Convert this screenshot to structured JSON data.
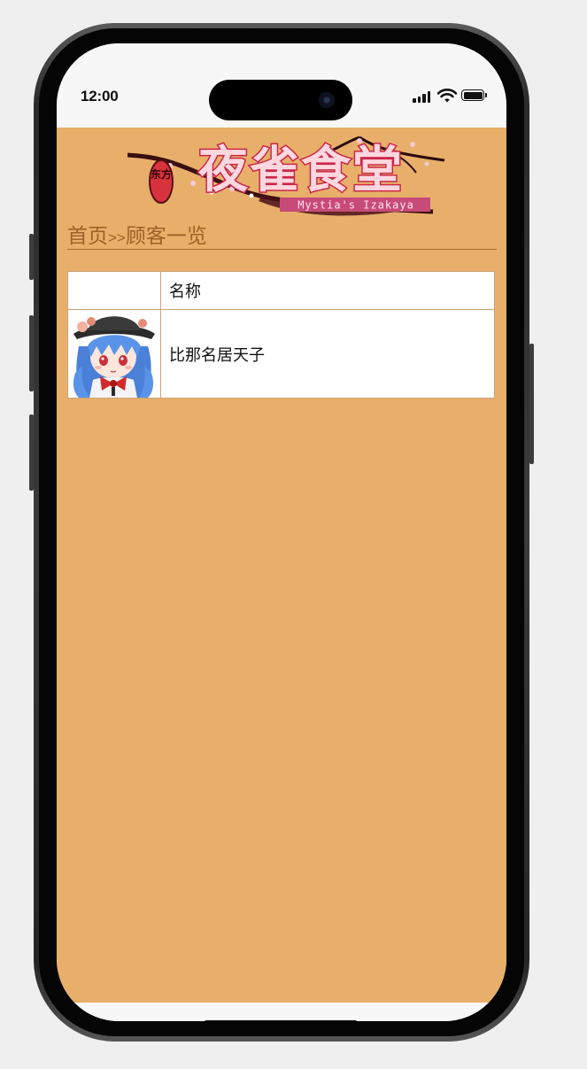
{
  "status_bar": {
    "time": "12:00"
  },
  "banner": {
    "title": "夜雀食堂",
    "badge": "东方",
    "subtitle": "Mystia's Izakaya"
  },
  "breadcrumb": {
    "home": "首页",
    "separator": ">>",
    "current": "顾客一览"
  },
  "customer_table": {
    "header_name": "名称",
    "rows": [
      {
        "name": "比那名居天子",
        "avatar": "tenshi-portrait"
      }
    ]
  },
  "colors": {
    "page_background": "#e8af6a",
    "breadcrumb_text": "#9b6229",
    "table_border": "#c9a27a"
  }
}
